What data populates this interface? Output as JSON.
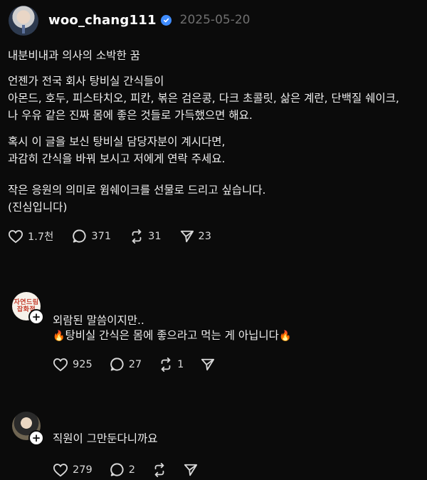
{
  "post": {
    "username": "woo_chang111",
    "date": "2025-05-20",
    "lines": [
      "내분비내과 의사의 소박한 꿈",
      "언젠가 전국 회사 탕비실 간식들이",
      "아몬드, 호두, 피스타치오, 피칸, 볶은 검은콩, 다크 초콜릿, 삶은 계란, 단백질 쉐이크,",
      "나 우유 같은 진짜 몸에 좋은 것들로 가득했으면 해요.",
      "혹시 이 글을 보신 탕비실 담당자분이 계시다면,",
      "과감히 간식을 바꿔 보시고 저에게 연락 주세요.",
      "작은 응원의 의미로 윔쉐이크를 선물로 드리고 싶습니다.",
      "(진심입니다)"
    ],
    "likes": "1.7천",
    "comments": "371",
    "reposts": "31",
    "shares": "23"
  },
  "replies": [
    {
      "avatar_text": [
        "자연드림",
        "잡화점"
      ],
      "line1": "외람된 말씀이지만..",
      "line2": "탕비실 간식은 몸에 좋으라고 먹는 게 아닙니다",
      "likes": "925",
      "comments": "27",
      "reposts": "1"
    },
    {
      "line1": "직원이 그만둔다니까요",
      "likes": "279",
      "comments": "2"
    }
  ],
  "icons": {
    "heart": "heart-icon",
    "comment": "comment-bubble-icon",
    "repost": "repost-icon",
    "share": "send-icon",
    "verified": "verified-badge-icon",
    "flame": "fire-emoji"
  },
  "colors": {
    "background": "#0b0b0b",
    "text": "#f0f0f0",
    "muted": "#6f6f6f",
    "verified": "#3f8cff"
  }
}
